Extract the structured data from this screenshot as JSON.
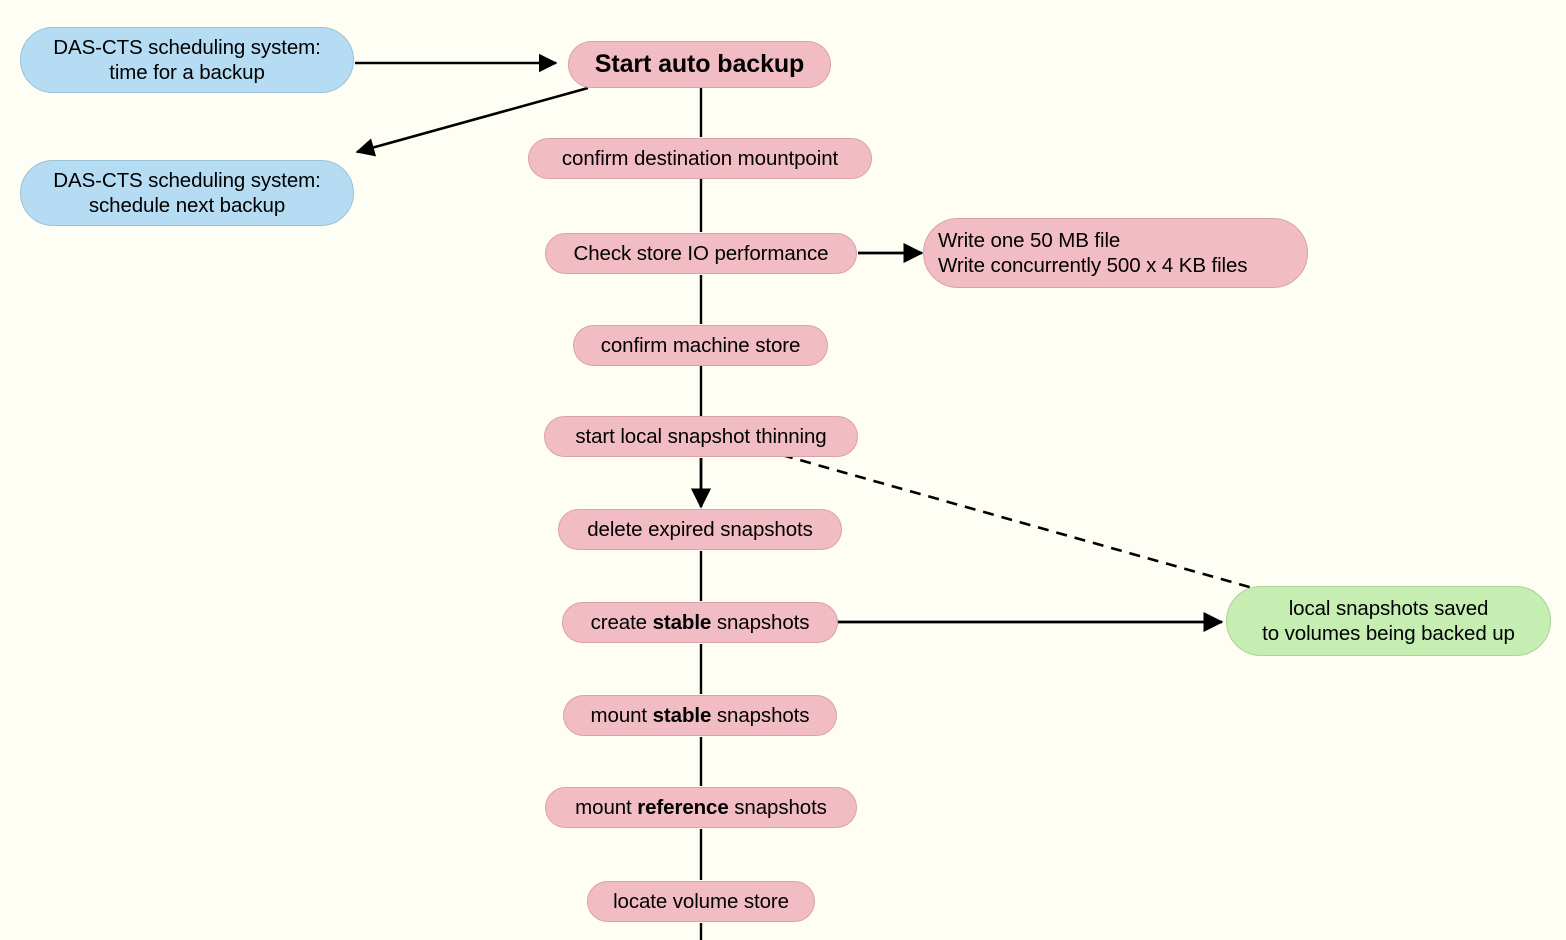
{
  "diagram": {
    "title_node": "Start auto backup",
    "background_color": "#fffef5",
    "palette": {
      "process_fill": "#f2bcc4",
      "external_fill": "#b5dcf2",
      "result_fill": "#c6eeb2",
      "edge_color": "#000000"
    },
    "nodes": [
      {
        "id": "sched_time",
        "label_line1": "DAS-CTS scheduling system:",
        "label_line2": "time for a backup",
        "type": "external",
        "color": "#b5dcf2"
      },
      {
        "id": "sched_next",
        "label_line1": "DAS-CTS scheduling system:",
        "label_line2": "schedule next backup",
        "type": "external",
        "color": "#b5dcf2"
      },
      {
        "id": "start",
        "label": "Start auto backup",
        "type": "process-start",
        "color": "#f2bcc4"
      },
      {
        "id": "confirm_dest",
        "label": "confirm destination mountpoint",
        "type": "process",
        "color": "#f2bcc4"
      },
      {
        "id": "check_io",
        "label": "Check store IO performance",
        "type": "process",
        "color": "#f2bcc4"
      },
      {
        "id": "io_detail",
        "label_line1": "Write one 50 MB file",
        "label_line2": "Write concurrently 500 x 4 KB files",
        "type": "process-note",
        "color": "#f2bcc4"
      },
      {
        "id": "confirm_machine",
        "label": "confirm machine store",
        "type": "process",
        "color": "#f2bcc4"
      },
      {
        "id": "thinning",
        "label": "start local snapshot thinning",
        "type": "process",
        "color": "#f2bcc4"
      },
      {
        "id": "delete_expired",
        "label": "delete expired snapshots",
        "type": "process",
        "color": "#f2bcc4"
      },
      {
        "id": "create_stable",
        "label_pre": "create ",
        "label_bold": "stable",
        "label_post": " snapshots",
        "type": "process",
        "color": "#f2bcc4"
      },
      {
        "id": "local_saved",
        "label_line1": "local snapshots saved",
        "label_line2": "to volumes being backed up",
        "type": "result",
        "color": "#c6eeb2"
      },
      {
        "id": "mount_stable",
        "label_pre": "mount ",
        "label_bold": "stable",
        "label_post": " snapshots",
        "type": "process",
        "color": "#f2bcc4"
      },
      {
        "id": "mount_reference",
        "label_pre": "mount ",
        "label_bold": "reference",
        "label_post": " snapshots",
        "type": "process",
        "color": "#f2bcc4"
      },
      {
        "id": "locate_volume",
        "label": "locate volume store",
        "type": "process",
        "color": "#f2bcc4"
      }
    ],
    "edges": [
      {
        "from": "sched_time",
        "to": "start",
        "style": "solid",
        "arrow": true
      },
      {
        "from": "start",
        "to": "sched_next",
        "style": "solid",
        "arrow": true
      },
      {
        "from": "start",
        "to": "confirm_dest",
        "style": "solid",
        "arrow": false
      },
      {
        "from": "confirm_dest",
        "to": "check_io",
        "style": "solid",
        "arrow": false
      },
      {
        "from": "check_io",
        "to": "io_detail",
        "style": "solid",
        "arrow": true
      },
      {
        "from": "check_io",
        "to": "confirm_machine",
        "style": "solid",
        "arrow": false
      },
      {
        "from": "confirm_machine",
        "to": "thinning",
        "style": "solid",
        "arrow": false
      },
      {
        "from": "thinning",
        "to": "delete_expired",
        "style": "solid",
        "arrow": true
      },
      {
        "from": "thinning",
        "to": "local_saved",
        "style": "dashed",
        "arrow": false
      },
      {
        "from": "delete_expired",
        "to": "create_stable",
        "style": "solid",
        "arrow": false
      },
      {
        "from": "create_stable",
        "to": "local_saved",
        "style": "solid",
        "arrow": true
      },
      {
        "from": "create_stable",
        "to": "mount_stable",
        "style": "solid",
        "arrow": false
      },
      {
        "from": "mount_stable",
        "to": "mount_reference",
        "style": "solid",
        "arrow": false
      },
      {
        "from": "mount_reference",
        "to": "locate_volume",
        "style": "solid",
        "arrow": false
      },
      {
        "from": "locate_volume",
        "to": "offscreen",
        "style": "solid",
        "arrow": false
      }
    ]
  }
}
